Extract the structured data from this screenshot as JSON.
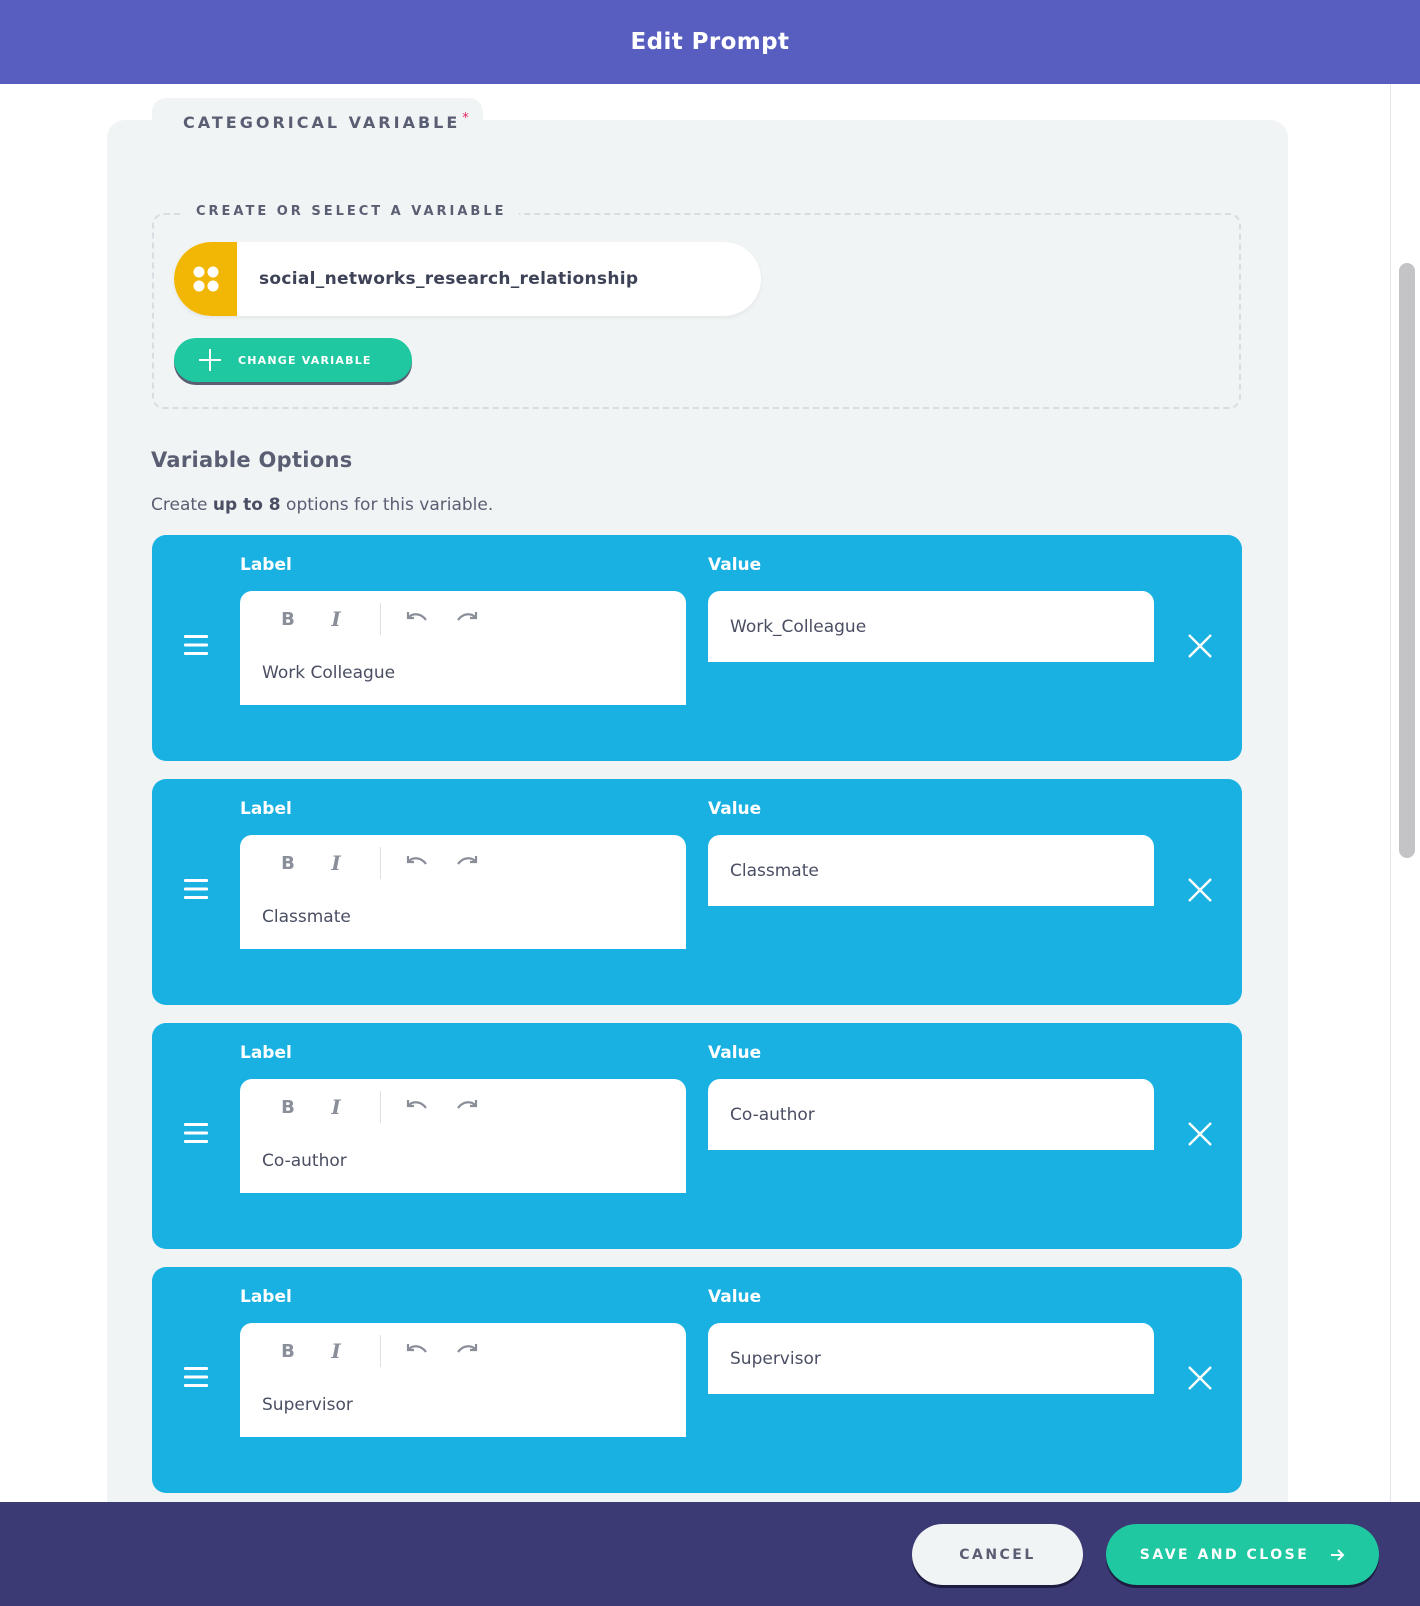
{
  "header": {
    "title": "Edit Prompt"
  },
  "section": {
    "title": "CATEGORICAL VARIABLE",
    "required_mark": "*",
    "fieldset_legend": "CREATE OR SELECT A VARIABLE",
    "variable_name": "social_networks_research_relationship",
    "variable_icon": "categorical-dots-icon",
    "change_button": "CHANGE VARIABLE"
  },
  "options": {
    "heading": "Variable Options",
    "help_prefix": "Create ",
    "help_bold": "up to 8",
    "help_suffix": " options for this variable.",
    "label_header": "Label",
    "value_header": "Value",
    "items": [
      {
        "label": "Work Colleague",
        "value": "Work_Colleague"
      },
      {
        "label": "Classmate",
        "value": "Classmate"
      },
      {
        "label": "Co-author",
        "value": "Co-author"
      },
      {
        "label": "Supervisor",
        "value": "Supervisor"
      }
    ],
    "toolbar": {
      "bold": "B",
      "italic": "I"
    }
  },
  "footer": {
    "cancel_label": "CANCEL",
    "save_label": "SAVE AND CLOSE"
  },
  "colors": {
    "header": "#585dc0",
    "option_card": "#18b1e2",
    "accent_green": "#1fc8a0",
    "variable_badge": "#f2b705",
    "footer": "#3c3a74",
    "required": "#e0245e"
  }
}
